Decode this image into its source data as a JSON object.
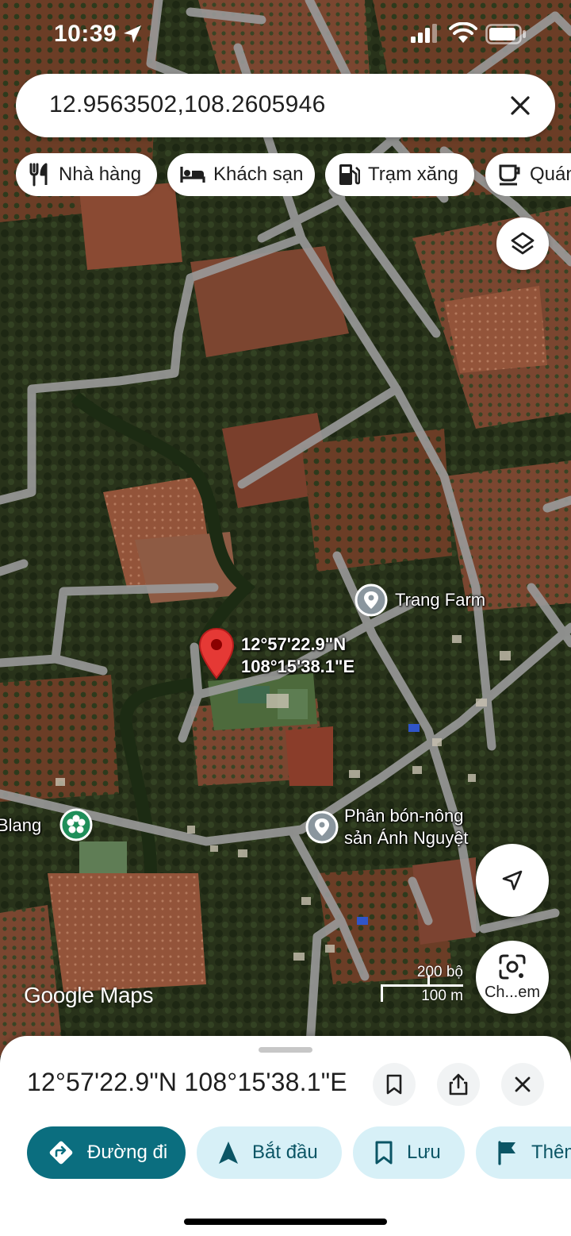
{
  "status": {
    "time": "10:39"
  },
  "search": {
    "query": "12.9563502,108.2605946",
    "clear_icon": "close-icon"
  },
  "chips": [
    {
      "label": "Nhà hàng",
      "icon": "restaurant-icon"
    },
    {
      "label": "Khách sạn",
      "icon": "hotel-icon"
    },
    {
      "label": "Trạm xăng",
      "icon": "gas-station-icon"
    },
    {
      "label": "Quán",
      "icon": "cafe-icon"
    }
  ],
  "map": {
    "pin_label_line1": "12°57'22.9\"N",
    "pin_label_line2": "108°15'38.1\"E",
    "pois": [
      {
        "line1": "Trang Farm",
        "line2": ""
      },
      {
        "line1": "Phân bón-nông",
        "line2": "sản Ánh Nguyệt"
      },
      {
        "line1": "Blang",
        "line2": ""
      }
    ],
    "scale_ft": "200 bộ",
    "scale_m": "100 m",
    "logo": "Google Maps",
    "lens_label": "Ch...em"
  },
  "sheet": {
    "title": "12°57'22.9\"N 108°15'38.1\"E",
    "actions": [
      {
        "label": "Đường đi",
        "icon": "directions-icon"
      },
      {
        "label": "Bắt đầu",
        "icon": "navigation-arrow-icon"
      },
      {
        "label": "Lưu",
        "icon": "bookmark-icon"
      },
      {
        "label": "Thêm",
        "icon": "flag-icon"
      }
    ]
  },
  "colors": {
    "accent": "#0b6e7f",
    "action_bg": "#d7f0f7",
    "pin": "#e53935",
    "road": "#9e9e9e"
  }
}
